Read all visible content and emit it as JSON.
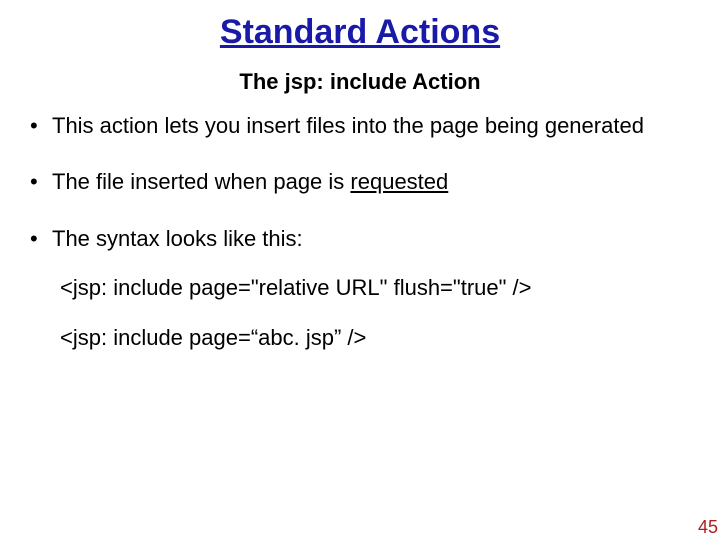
{
  "title": "Standard Actions",
  "subtitle": "The jsp: include Action",
  "bullets": {
    "b1": "This action lets you insert files into the page being generated",
    "b2_pre": "The file inserted when page is ",
    "b2_underlined": "requested",
    "b3": "The syntax looks like this:"
  },
  "code": {
    "line1": "<jsp: include page=\"relative URL\" flush=\"true\" />",
    "line2": "<jsp: include page=“abc. jsp” />"
  },
  "page_number": "45"
}
